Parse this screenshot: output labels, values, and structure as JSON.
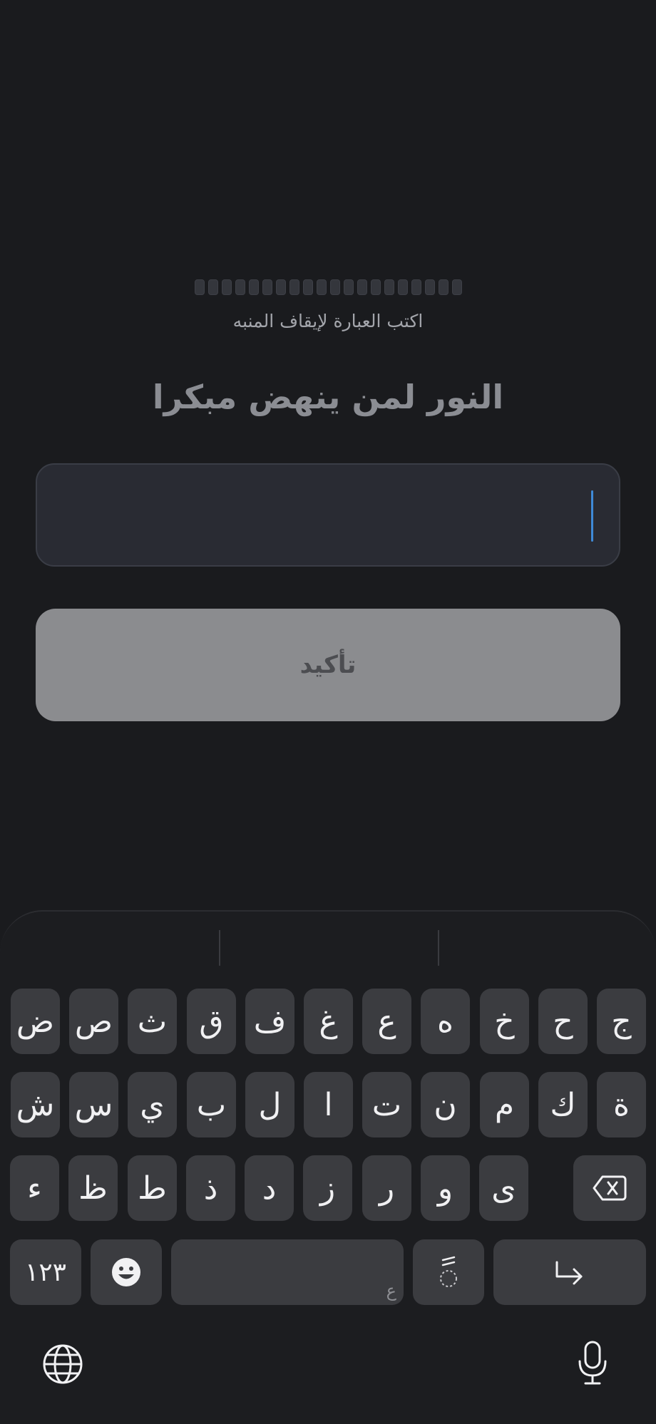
{
  "alarm": {
    "progress_total": 20,
    "progress_filled": 0,
    "instruction": "اكتب العبارة لإيقاف المنبه",
    "phrase": "النور لمن ينهض مبكرا",
    "input_value": "",
    "confirm_label": "تأكيد"
  },
  "keyboard": {
    "row1": [
      "ج",
      "ح",
      "خ",
      "ه",
      "ع",
      "غ",
      "ف",
      "ق",
      "ث",
      "ص",
      "ض"
    ],
    "row2": [
      "ة",
      "ك",
      "م",
      "ن",
      "ت",
      "ا",
      "ل",
      "ب",
      "ي",
      "س",
      "ش"
    ],
    "row3": [
      "ى",
      "و",
      "ر",
      "ز",
      "د",
      "ذ",
      "ط",
      "ظ",
      "ء"
    ],
    "numbers_label": "١٢٣",
    "space_hint": "ع",
    "diacritic_label": "ًً",
    "icons": {
      "backspace": "backspace-icon",
      "emoji": "emoji-icon",
      "enter": "enter-icon",
      "globe": "globe-icon",
      "mic": "microphone-icon"
    }
  }
}
